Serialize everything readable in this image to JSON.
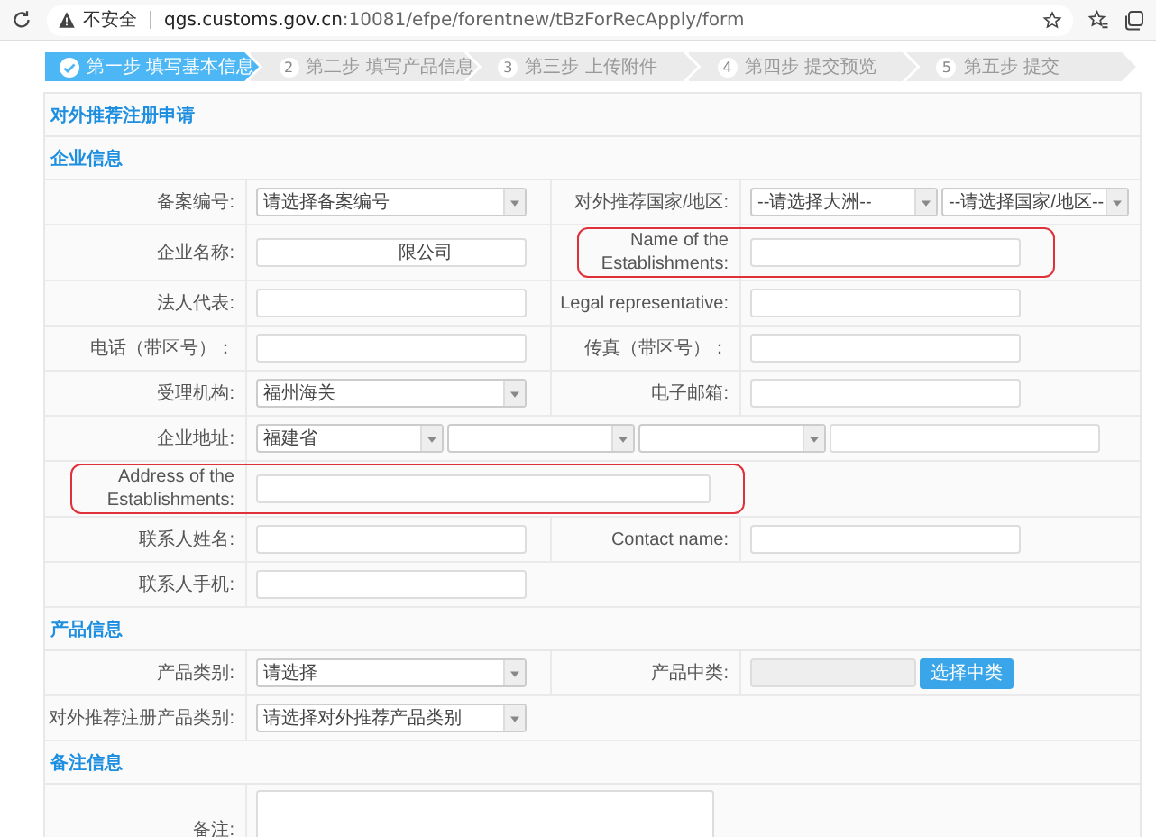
{
  "browser": {
    "security": "不安全",
    "url_host": "qgs.customs.gov.cn",
    "url_path": ":10081/efpe/forentnew/tBzForRecApply/form"
  },
  "steps": [
    {
      "label": "第一步 填写基本信息",
      "selected": true
    },
    {
      "number": "2",
      "label": "第二步 填写产品信息",
      "selected": false
    },
    {
      "number": "3",
      "label": "第三步 上传附件",
      "selected": false
    },
    {
      "number": "4",
      "label": "第四步 提交预览",
      "selected": false
    },
    {
      "number": "5",
      "label": "第五步 提交",
      "selected": false
    }
  ],
  "form": {
    "title": "对外推荐注册申请",
    "sections": [
      {
        "heading": "企业信息",
        "rows": [
          {
            "left": {
              "label": "备案编号:",
              "highlighted": false,
              "fields": [
                {
                  "kind": "select",
                  "value": "请选择备案编号"
                }
              ]
            },
            "right": {
              "label": "对外推荐国家/地区:",
              "highlighted": false,
              "fields": [
                {
                  "kind": "select",
                  "value": "--请选择大洲--"
                },
                {
                  "kind": "select",
                  "value": "--请选择国家/地区--"
                }
              ]
            }
          },
          {
            "left": {
              "label": "企业名称:",
              "highlighted": false,
              "fields": [
                {
                  "kind": "input",
                  "value": "限公司"
                }
              ]
            },
            "right": {
              "label": "Name of the Establishments:",
              "highlighted": true,
              "fields": [
                {
                  "kind": "input"
                }
              ]
            }
          },
          {
            "left": {
              "label": "法人代表:",
              "highlighted": false,
              "fields": [
                {
                  "kind": "input"
                }
              ]
            },
            "right": {
              "label": "Legal representative:",
              "highlighted": false,
              "fields": [
                {
                  "kind": "input"
                }
              ]
            }
          },
          {
            "left": {
              "label": "电话（带区号）：",
              "highlighted": false,
              "fields": [
                {
                  "kind": "input"
                }
              ]
            },
            "right": {
              "label": "传真（带区号）：",
              "highlighted": false,
              "fields": [
                {
                  "kind": "input"
                }
              ]
            }
          },
          {
            "left": {
              "label": "受理机构:",
              "highlighted": false,
              "fields": [
                {
                  "kind": "select",
                  "value": "福州海关"
                }
              ]
            },
            "right": {
              "label": "电子邮箱:",
              "highlighted": false,
              "fields": [
                {
                  "kind": "input"
                }
              ]
            }
          },
          {
            "left": {
              "label": "企业地址:",
              "highlighted": false,
              "fields": [
                {
                  "kind": "select",
                  "value": "福建省"
                },
                {
                  "kind": "select"
                },
                {
                  "kind": "select"
                },
                {
                  "kind": "input"
                }
              ]
            }
          },
          {
            "left": {
              "label": "Address of the Establishments:",
              "highlighted": true,
              "fields": [
                {
                  "kind": "input"
                }
              ]
            }
          },
          {
            "left": {
              "label": "联系人姓名:",
              "highlighted": false,
              "fields": [
                {
                  "kind": "input"
                }
              ]
            },
            "right": {
              "label": "Contact name:",
              "highlighted": false,
              "fields": [
                {
                  "kind": "input"
                }
              ]
            }
          },
          {
            "left": {
              "label": "联系人手机:",
              "highlighted": false,
              "fields": [
                {
                  "kind": "input"
                }
              ]
            }
          }
        ]
      },
      {
        "heading": "产品信息",
        "rows": [
          {
            "left": {
              "label": "产品类别:",
              "highlighted": false,
              "fields": [
                {
                  "kind": "select",
                  "value": "请选择"
                }
              ]
            },
            "right": {
              "label": "产品中类:",
              "highlighted": false,
              "fields": [
                {
                  "kind": "readonly"
                },
                {
                  "kind": "button",
                  "label": "选择中类"
                }
              ]
            }
          },
          {
            "left": {
              "label": "对外推荐注册产品类别:",
              "highlighted": false,
              "fields": [
                {
                  "kind": "select",
                  "value": "请选择对外推荐产品类别"
                }
              ]
            }
          }
        ]
      },
      {
        "heading": "备注信息",
        "rows": [
          {
            "left": {
              "label": "备注:",
              "highlighted": false,
              "fields": [
                {
                  "kind": "textarea"
                }
              ]
            }
          }
        ]
      }
    ]
  }
}
